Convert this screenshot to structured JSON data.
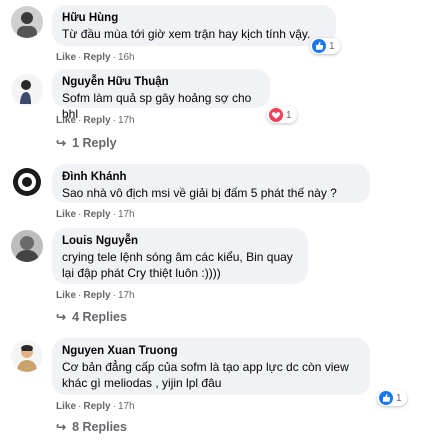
{
  "comments": [
    {
      "name": "Hữu Hùng",
      "text": "Từ đầu mùa tới giờ xem trận hay kịch tính vậy.",
      "like": "Like",
      "reply": "Reply",
      "time": "16h",
      "reaction": {
        "type": "like-icon",
        "count": "1",
        "color": "#1877f2"
      }
    },
    {
      "name": "Nguyễn Hữu Thuận",
      "text": "Sofm làm quả sp gây hoảng sợ cho bhl",
      "like": "Like",
      "reply": "Reply",
      "time": "17h",
      "reaction": {
        "type": "love-icon",
        "count": "1",
        "color": "#f33e58"
      },
      "replies": "1 Reply"
    },
    {
      "name": "Đình Khánh",
      "text": "Sao nhà vô địch msi về giải bị đấm 5 phát thế này ?",
      "like": "Like",
      "reply": "Reply",
      "time": "17h"
    },
    {
      "name": "Louis Nguyễn",
      "text": "crying tele lệnh sóng âm các kiểu, Bin quay lại đập phát Cry thiệt luôn :))))",
      "like": "Like",
      "reply": "Reply",
      "time": "17h",
      "replies": "4 Replies"
    },
    {
      "name": "Nguyen Xuan Truong",
      "text": "Cơ bản đẳng cấp của sofm là tạo app lực dc còn view khác gì meliodas , yijin lpl đâu",
      "like": "Like",
      "reply": "Reply",
      "time": "17h",
      "reaction": {
        "type": "like-icon",
        "count": "1",
        "color": "#1877f2"
      },
      "replies": "8 Replies"
    }
  ],
  "colors": {
    "bubble": "#f0f2f5",
    "meta": "#65676b",
    "like_blue": "#1877f2",
    "love_red": "#f33e58"
  }
}
